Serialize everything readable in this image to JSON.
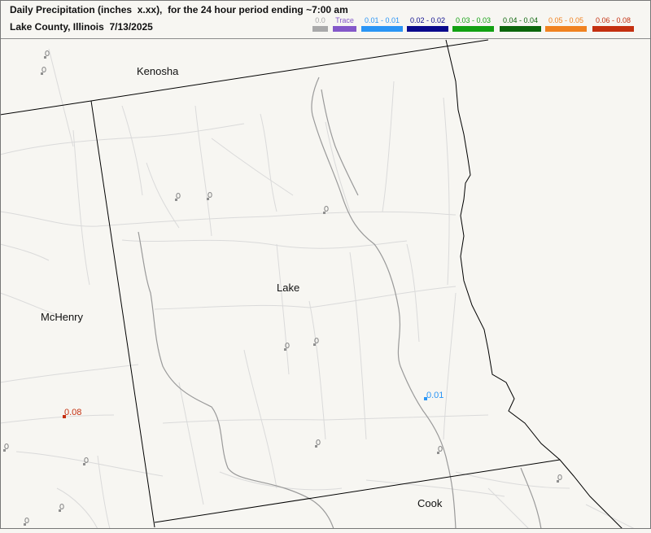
{
  "header": {
    "title_line1": "Daily Precipitation (inches  x.xx),  for the 24 hour period ending ~7:00 am",
    "title_line2": "Lake County, Illinois  7/13/2025"
  },
  "legend": [
    {
      "label": "0.0",
      "color": "#a9a9a9"
    },
    {
      "label": "Trace",
      "color": "#8458c9"
    },
    {
      "label": "0.01 - 0.01",
      "color": "#2a95f5"
    },
    {
      "label": "0.02 - 0.02",
      "color": "#0a0a8c"
    },
    {
      "label": "0.03 - 0.03",
      "color": "#12a112"
    },
    {
      "label": "0.04 - 0.04",
      "color": "#0c660c"
    },
    {
      "label": "0.05 - 0.05",
      "color": "#f08220"
    },
    {
      "label": "0.06 - 0.08",
      "color": "#c43010"
    }
  ],
  "counties": {
    "kenosha": "Kenosha",
    "lake": "Lake",
    "mchenry": "McHenry",
    "cook": "Cook"
  },
  "observations": {
    "mchenry_station": {
      "value": "0.08",
      "color": "#c43010"
    },
    "lake_station": {
      "value": "0.01",
      "color": "#2a95f5"
    }
  },
  "map_icons": {
    "no_report_marker": "rain-gauge-icon"
  }
}
